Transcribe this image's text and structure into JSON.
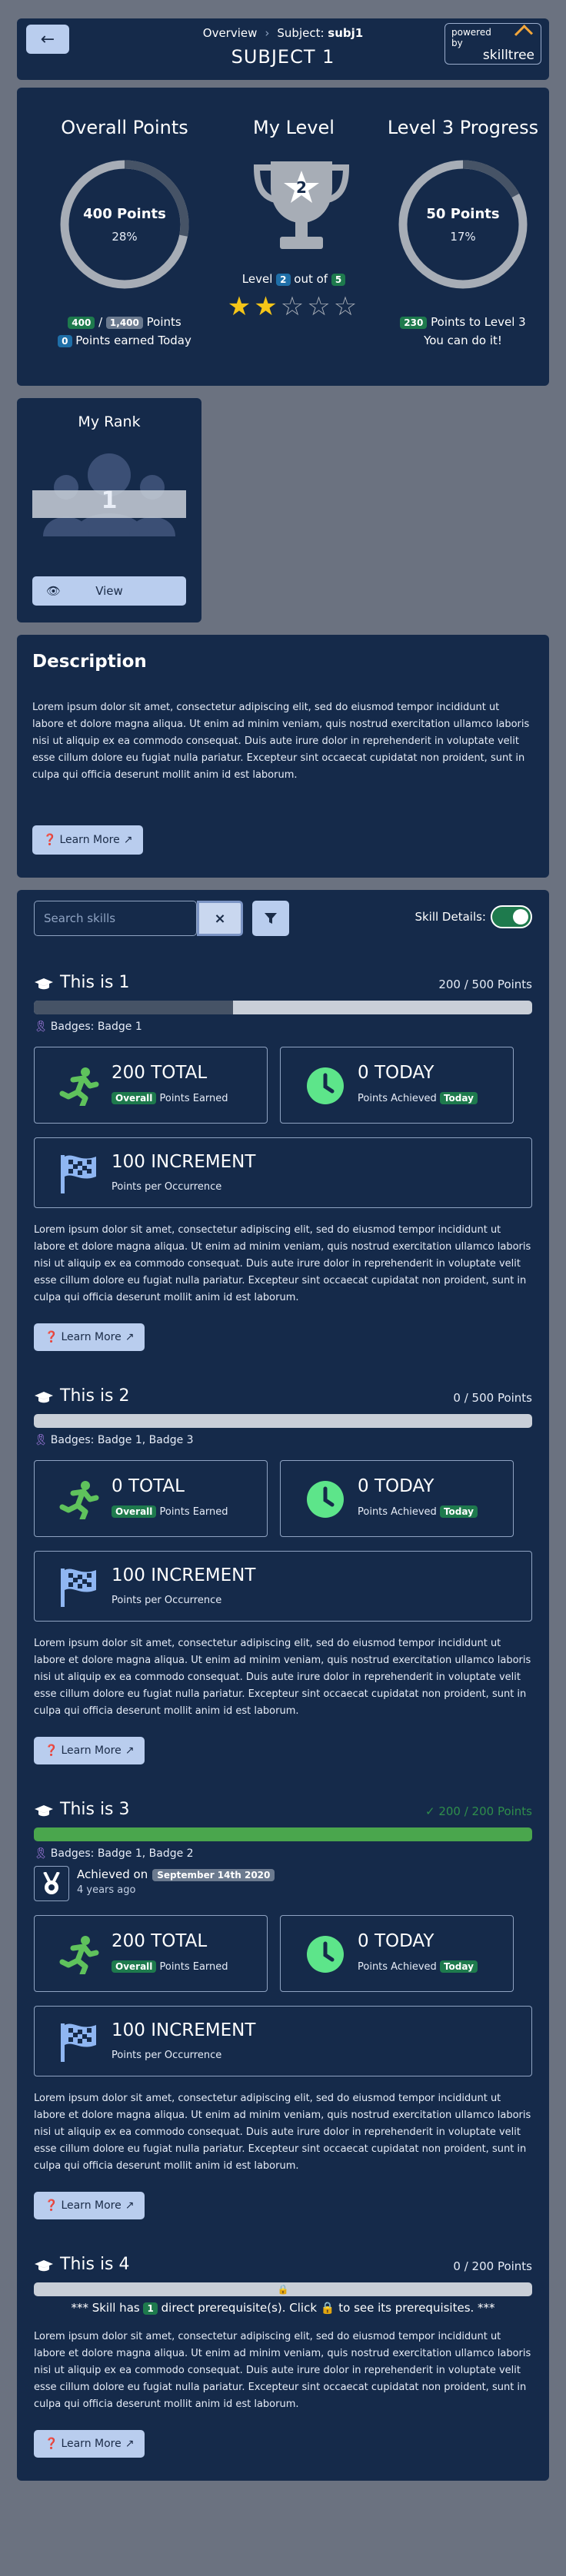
{
  "header": {
    "breadcrumb_root": "Overview",
    "breadcrumb_current_prefix": "Subject: ",
    "breadcrumb_current_name": "subj1",
    "title": "SUBJECT 1",
    "powered_by": "powered by",
    "brand": "skilltree"
  },
  "overview": {
    "overall": {
      "title": "Overall Points",
      "points_label": "400 Points",
      "percent_label": "28%",
      "percent": 28,
      "earned": "400",
      "total": "1,400",
      "points_word": "Points",
      "today_count": "0",
      "today_text": "Points earned Today"
    },
    "level": {
      "title": "My Level",
      "level_number": "2",
      "level_prefix": "Level",
      "out_of": "out of",
      "max_level": "5",
      "stars_filled": 2,
      "stars_total": 5
    },
    "progress": {
      "title": "Level 3 Progress",
      "points_label": "50 Points",
      "percent_label": "17%",
      "percent": 17,
      "to_next": "230",
      "to_next_text": "Points to Level 3",
      "encourage": "You can do it!"
    }
  },
  "rank": {
    "title": "My Rank",
    "rank_value": "1",
    "view_label": "View"
  },
  "description": {
    "title": "Description",
    "text": "Lorem ipsum dolor sit amet, consectetur adipiscing elit, sed do eiusmod tempor incididunt ut labore et dolore magna aliqua. Ut enim ad minim veniam, quis nostrud exercitation ullamco laboris nisi ut aliquip ex ea commodo consequat. Duis aute irure dolor in reprehenderit in voluptate velit esse cillum dolore eu fugiat nulla pariatur. Excepteur sint occaecat cupidatat non proident, sunt in culpa qui officia deserunt mollit anim id est laborum.",
    "learn_more": "Learn More"
  },
  "skills_panel": {
    "search_placeholder": "Search skills",
    "clear_label": "×",
    "skill_details_label": "Skill Details:",
    "skill_details_on": true,
    "skills": [
      {
        "name": "This is 1",
        "points": "200 / 500 Points",
        "progress": 0.4,
        "badges": "Badges: Badge 1",
        "total": "200 TOTAL",
        "total_tag": "Overall",
        "total_sub": "Points Earned",
        "today": "0 TODAY",
        "today_sub": "Points Achieved",
        "today_tag": "Today",
        "increment": "100 INCREMENT",
        "increment_sub": "Points per Occurrence",
        "text": "Lorem ipsum dolor sit amet, consectetur adipiscing elit, sed do eiusmod tempor incididunt ut labore et dolore magna aliqua. Ut enim ad minim veniam, quis nostrud exercitation ullamco laboris nisi ut aliquip ex ea commodo consequat. Duis aute irure dolor in reprehenderit in voluptate velit esse cillum dolore eu fugiat nulla pariatur. Excepteur sint occaecat cupidatat non proident, sunt in culpa qui officia deserunt mollit anim id est laborum.",
        "learn_more": "Learn More"
      },
      {
        "name": "This is 2",
        "points": "0 / 500 Points",
        "progress": 0,
        "badges": "Badges: Badge 1, Badge 3",
        "total": "0 TOTAL",
        "total_tag": "Overall",
        "total_sub": "Points Earned",
        "today": "0 TODAY",
        "today_sub": "Points Achieved",
        "today_tag": "Today",
        "increment": "100 INCREMENT",
        "increment_sub": "Points per Occurrence",
        "text": "Lorem ipsum dolor sit amet, consectetur adipiscing elit, sed do eiusmod tempor incididunt ut labore et dolore magna aliqua. Ut enim ad minim veniam, quis nostrud exercitation ullamco laboris nisi ut aliquip ex ea commodo consequat. Duis aute irure dolor in reprehenderit in voluptate velit esse cillum dolore eu fugiat nulla pariatur. Excepteur sint occaecat cupidatat non proident, sunt in culpa qui officia deserunt mollit anim id est laborum.",
        "learn_more": "Learn More"
      },
      {
        "name": "This is 3",
        "points": "✓ 200 / 200 Points",
        "progress": 1,
        "badges": "Badges: Badge 1, Badge 2",
        "achieved_label": "Achieved on",
        "achieved_date": "September 14th 2020",
        "achieved_ago": "4 years ago",
        "total": "200 TOTAL",
        "total_tag": "Overall",
        "total_sub": "Points Earned",
        "today": "0 TODAY",
        "today_sub": "Points Achieved",
        "today_tag": "Today",
        "increment": "100 INCREMENT",
        "increment_sub": "Points per Occurrence",
        "text": "Lorem ipsum dolor sit amet, consectetur adipiscing elit, sed do eiusmod tempor incididunt ut labore et dolore magna aliqua. Ut enim ad minim veniam, quis nostrud exercitation ullamco laboris nisi ut aliquip ex ea commodo consequat. Duis aute irure dolor in reprehenderit in voluptate velit esse cillum dolore eu fugiat nulla pariatur. Excepteur sint occaecat cupidatat non proident, sunt in culpa qui officia deserunt mollit anim id est laborum.",
        "learn_more": "Learn More"
      },
      {
        "name": "This is 4",
        "points": "0 / 200 Points",
        "progress": 0,
        "prereq_prefix": "*** Skill has",
        "prereq_count": "1",
        "prereq_mid": "direct prerequisite(s). Click",
        "prereq_suffix": "to see its prerequisites. ***",
        "text": "Lorem ipsum dolor sit amet, consectetur adipiscing elit, sed do eiusmod tempor incididunt ut labore et dolore magna aliqua. Ut enim ad minim veniam, quis nostrud exercitation ullamco laboris nisi ut aliquip ex ea commodo consequat. Duis aute irure dolor in reprehenderit in voluptate velit esse cillum dolore eu fugiat nulla pariatur. Excepteur sint occaecat cupidatat non proident, sunt in culpa qui officia deserunt mollit anim id est laborum.",
        "learn_more": "Learn More"
      }
    ]
  },
  "colors": {
    "page_bg": "#6b7280",
    "card_bg": "#152a4a",
    "accent_button": "#b9cdee",
    "success": "#4aa64d",
    "badge_green": "#1e7a4d",
    "star": "#f5c518"
  }
}
